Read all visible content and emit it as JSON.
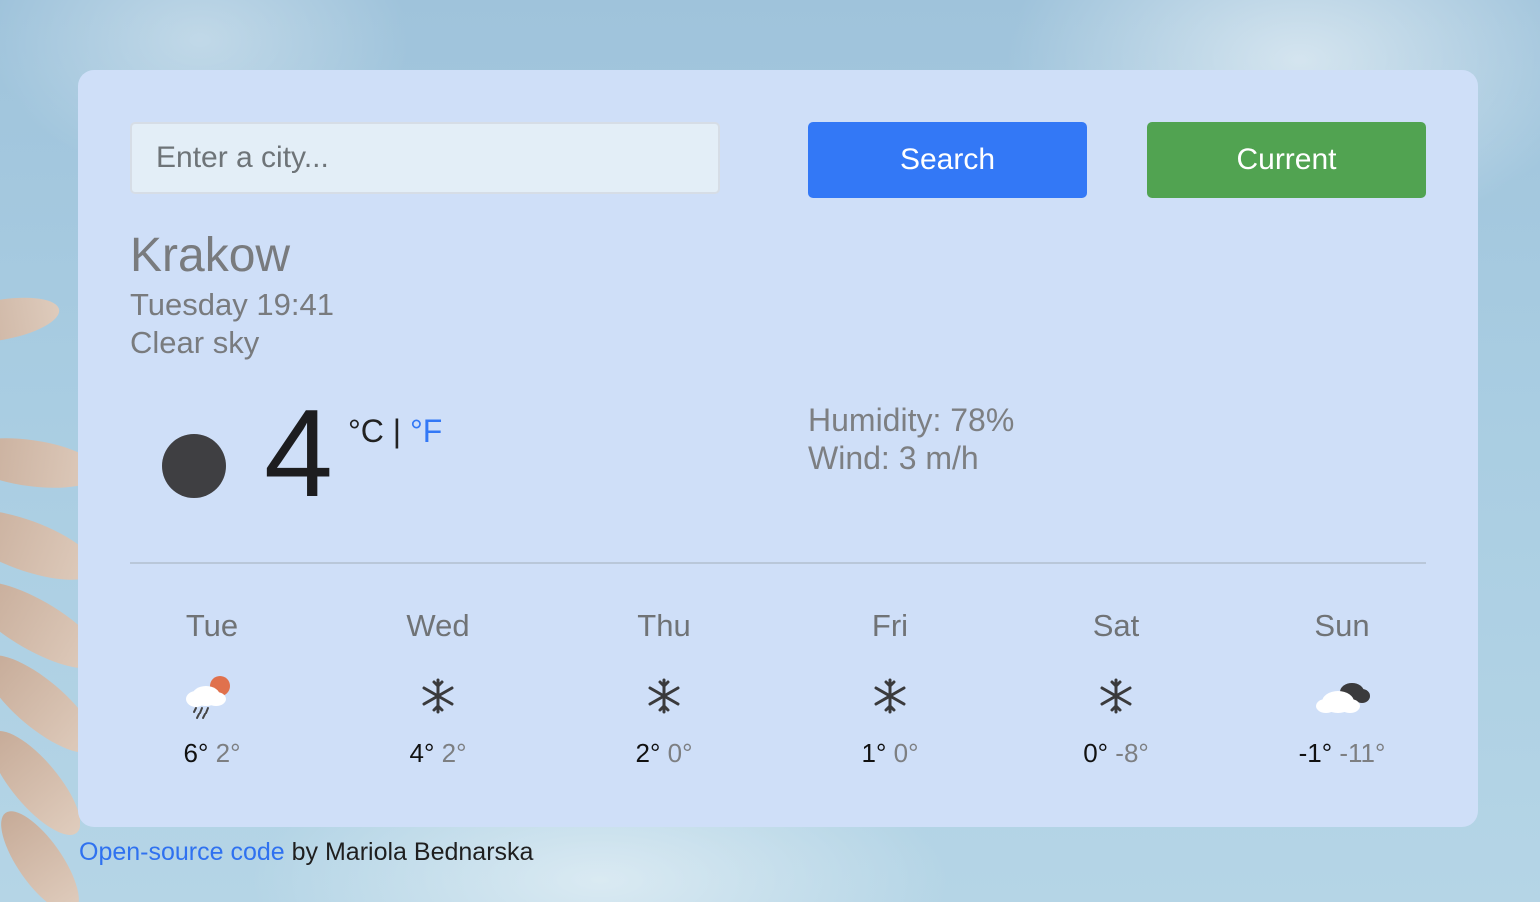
{
  "search": {
    "placeholder": "Enter a city...",
    "button_label": "Search",
    "current_label": "Current"
  },
  "current": {
    "city": "Krakow",
    "date": "Tuesday 19:41",
    "description": "Clear sky",
    "temperature": "4",
    "unit_c": "°C",
    "unit_sep": " | ",
    "unit_f": "°F",
    "humidity": "Humidity: 78%",
    "wind": "Wind: 3 m/h",
    "icon": "moon-icon"
  },
  "forecast": [
    {
      "day": "Tue",
      "icon": "rain-sun-icon",
      "max": "6°",
      "min": "2°"
    },
    {
      "day": "Wed",
      "icon": "snowflake-icon",
      "max": "4°",
      "min": "2°"
    },
    {
      "day": "Thu",
      "icon": "snowflake-icon",
      "max": "2°",
      "min": "0°"
    },
    {
      "day": "Fri",
      "icon": "snowflake-icon",
      "max": "1°",
      "min": "0°"
    },
    {
      "day": "Sat",
      "icon": "snowflake-icon",
      "max": "0°",
      "min": "-8°"
    },
    {
      "day": "Sun",
      "icon": "cloudy-icon",
      "max": "-1°",
      "min": "-11°"
    }
  ],
  "footer": {
    "link_text": "Open-source code",
    "text": " by Mariola Bednarska"
  },
  "colors": {
    "search_button": "#3378f6",
    "current_button": "#51a351",
    "card": "#cfdff8",
    "link": "#2f71f0"
  }
}
